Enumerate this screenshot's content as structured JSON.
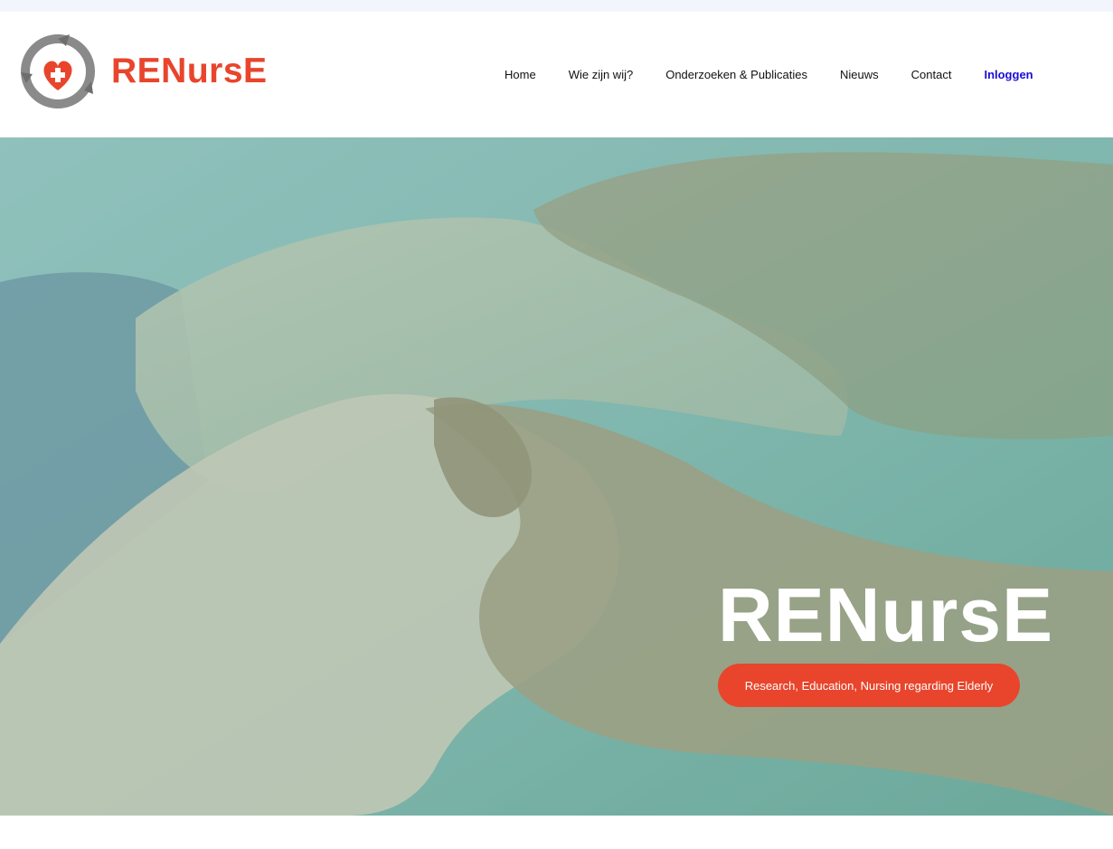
{
  "brand": {
    "name": "RENursE",
    "accent": "#e8452c"
  },
  "nav": {
    "items": [
      {
        "label": "Home"
      },
      {
        "label": "Wie zijn wij?"
      },
      {
        "label": "Onderzoeken & Publicaties"
      },
      {
        "label": "Nieuws"
      },
      {
        "label": "Contact"
      },
      {
        "label": "Inloggen"
      }
    ]
  },
  "hero": {
    "title": "RENursE",
    "tagline": "Research, Education, Nursing regarding Elderly",
    "image": "holding-hands-photo"
  }
}
